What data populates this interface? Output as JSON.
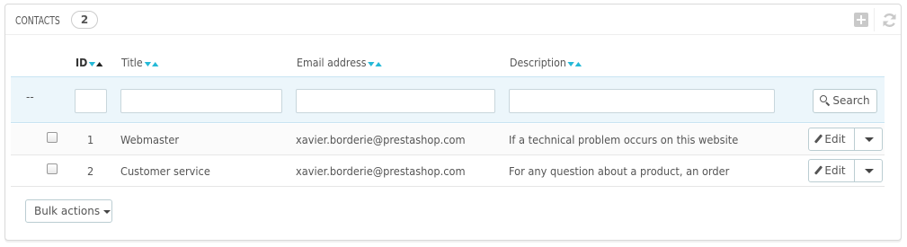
{
  "panel": {
    "title": "Contacts",
    "count": "2",
    "toolbar": {
      "add_icon": "plus-square-icon",
      "refresh_icon": "refresh-icon"
    }
  },
  "table": {
    "columns": [
      {
        "label": "ID",
        "sort": "asc"
      },
      {
        "label": "Title"
      },
      {
        "label": "Email address"
      },
      {
        "label": "Description"
      }
    ],
    "filter": {
      "placeholder_dash": "--",
      "id": "",
      "title": "",
      "email": "",
      "description": "",
      "search_label": "Search"
    },
    "rows": [
      {
        "id": "1",
        "title": "Webmaster",
        "email": "xavier.borderie@prestashop.com",
        "description": "If a technical problem occurs on this website",
        "edit_label": "Edit"
      },
      {
        "id": "2",
        "title": "Customer service",
        "email": "xavier.borderie@prestashop.com",
        "description": "For any question about a product, an order",
        "edit_label": "Edit"
      }
    ]
  },
  "footer": {
    "bulk_actions_label": "Bulk actions"
  },
  "colors": {
    "accent": "#25b9d7",
    "filter_bg": "#ecf6fb",
    "border": "#bbcdd2"
  }
}
